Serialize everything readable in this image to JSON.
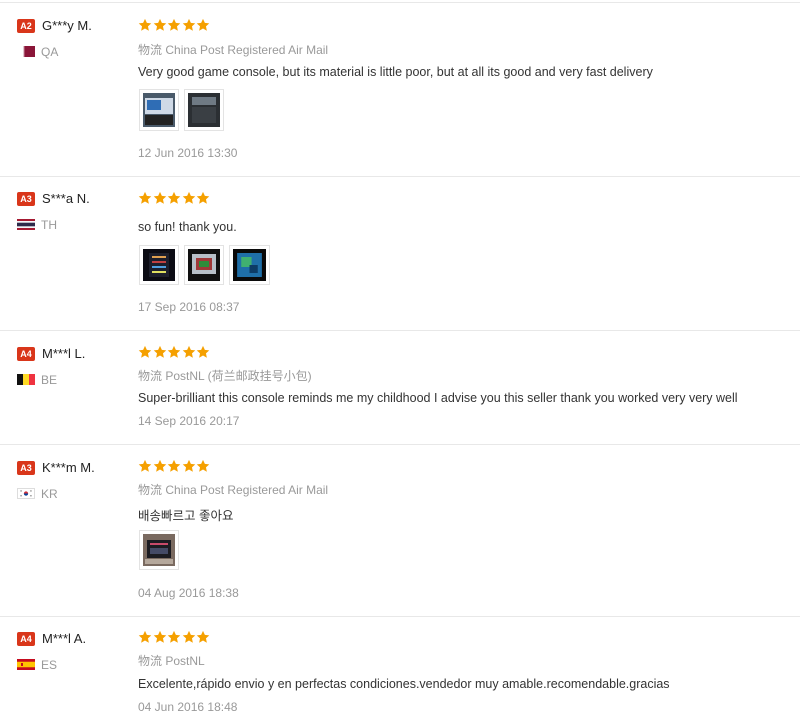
{
  "reviews": [
    {
      "level": "A2",
      "name": "G***y M.",
      "country": "QA",
      "flag": "qa-flag",
      "rating": 5,
      "shipping_label": "物流",
      "shipping": "China Post Registered Air Mail",
      "comment": "Very good game console, but its material is little poor, but at all its good and very fast delivery",
      "photo_count": 2,
      "date": "12 Jun 2016 13:30"
    },
    {
      "level": "A3",
      "name": "S***a N.",
      "country": "TH",
      "flag": "th-flag",
      "rating": 5,
      "shipping_label": "",
      "shipping": "",
      "comment": "so fun! thank you.",
      "photo_count": 3,
      "date": "17 Sep 2016 08:37"
    },
    {
      "level": "A4",
      "name": "M***l L.",
      "country": "BE",
      "flag": "be-flag",
      "rating": 5,
      "shipping_label": "物流",
      "shipping": "PostNL (荷兰邮政挂号小包)",
      "comment": "Super-brilliant this console reminds me my childhood I advise you this seller thank you worked very very well",
      "photo_count": 0,
      "date": "14 Sep 2016 20:17"
    },
    {
      "level": "A3",
      "name": "K***m M.",
      "country": "KR",
      "flag": "kr-flag",
      "rating": 5,
      "shipping_label": "物流",
      "shipping": "China Post Registered Air Mail",
      "comment": "배송빠르고 좋아요",
      "photo_count": 1,
      "date": "04 Aug 2016 18:38"
    },
    {
      "level": "A4",
      "name": "M***l A.",
      "country": "ES",
      "flag": "es-flag",
      "rating": 5,
      "shipping_label": "物流",
      "shipping": "PostNL",
      "comment": "Excelente,rápido envio y en perfectas condiciones.vendedor muy amable.recomendable.gracias",
      "photo_count": 0,
      "date": "04 Jun 2016 18:48"
    }
  ],
  "colors": {
    "badge": "#d9361a",
    "star": "#f5a000",
    "muted": "#999999",
    "divider": "#e8e8e8"
  }
}
